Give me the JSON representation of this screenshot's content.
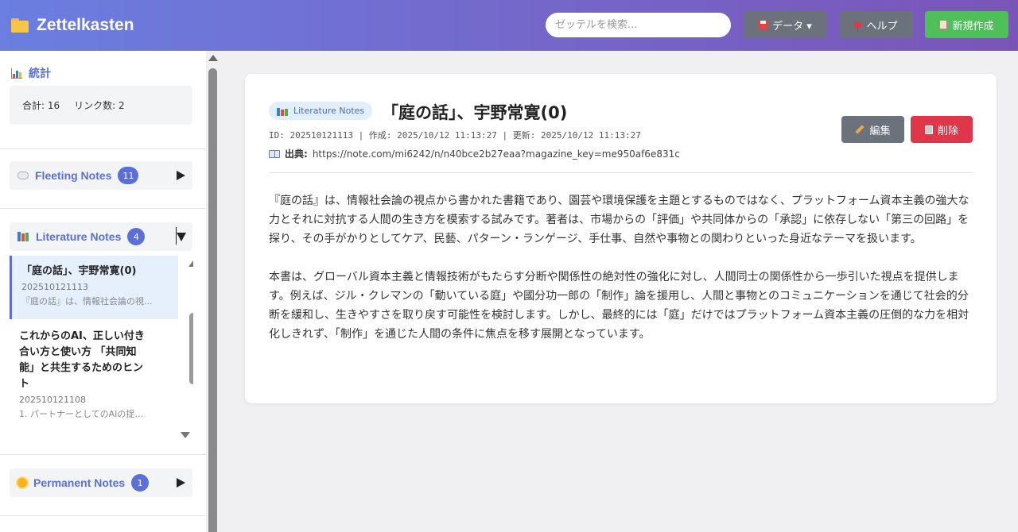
{
  "header": {
    "title": "Zettelkasten",
    "search_placeholder": "ゼッテルを検索...",
    "data_button": "データ ▾",
    "help_button": "ヘルプ",
    "new_button": "新規作成"
  },
  "sidebar": {
    "stats": {
      "title": "統計",
      "total": "合計: 16",
      "links": "リンク数: 2"
    },
    "sections": [
      {
        "title": "Fleeting Notes",
        "count": "11"
      },
      {
        "title": "Literature Notes",
        "count": "4"
      },
      {
        "title": "Permanent Notes",
        "count": "1"
      }
    ],
    "literature_items": [
      {
        "title": "「庭の話」、宇野常寛(0)",
        "id": "202510121113",
        "excerpt": "『庭の話』は、情報社会論の視..."
      },
      {
        "title": "これからのAI、正しい付き合い方と使い方 「共同知能」と共生するためのヒント",
        "id": "202510121108",
        "excerpt": "1. パートナーとしてのAIの捉え..."
      }
    ]
  },
  "note": {
    "type_badge": "Literature Notes",
    "title": "「庭の話」、宇野常寛(0)",
    "meta": "ID: 202510121113 | 作成: 2025/10/12 11:13:27 | 更新: 2025/10/12 11:13:27",
    "source_label": "出典:",
    "source_url": "https://note.com/mi6242/n/n40bce2b27eaa?magazine_key=me950af6e831c",
    "edit_button": "編集",
    "delete_button": "削除",
    "paragraphs": [
      "『庭の話』は、情報社会論の視点から書かれた書籍であり、園芸や環境保護を主題とするものではなく、プラットフォーム資本主義の強大な力とそれに対抗する人間の生き方を模索する試みです。著者は、市場からの「評価」や共同体からの「承認」に依存しない「第三の回路」を探り、その手がかりとしてケア、民藝、パターン・ランゲージ、手仕事、自然や事物との関わりといった身近なテーマを扱います。",
      "本書は、グローバル資本主義と情報技術がもたらす分断や関係性の絶対性の強化に対し、人間同士の関係性から一歩引いた視点を提供します。例えば、ジル・クレマンの「動いている庭」や國分功一郎の「制作」論を援用し、人間と事物とのコミュニケーションを通じて社会的分断を緩和し、生きやすさを取り戻す可能性を検討します。しかし、最終的には「庭」だけではプラットフォーム資本主義の圧倒的な力を相対化しきれず、「制作」を通じた人間の条件に焦点を移す展開となっています。"
    ]
  }
}
